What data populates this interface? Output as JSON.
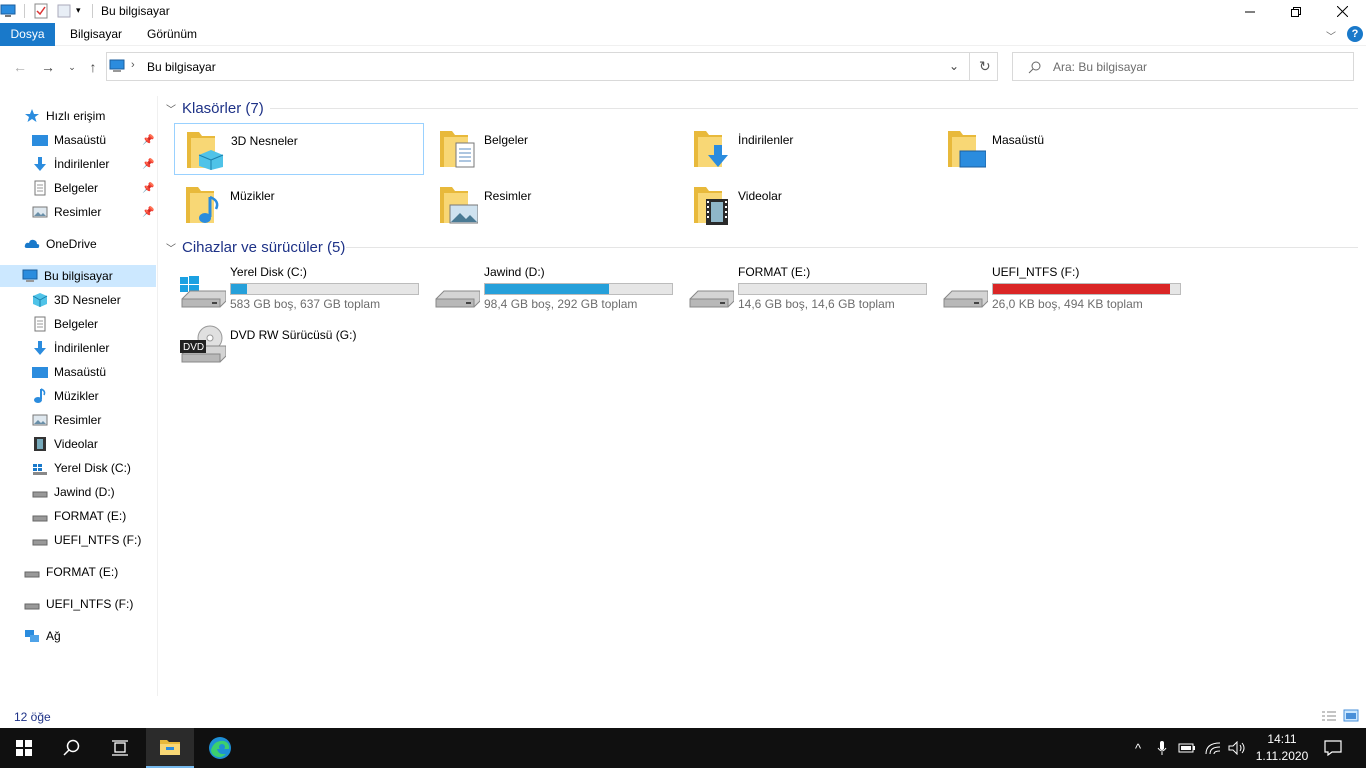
{
  "window": {
    "title": "Bu bilgisayar"
  },
  "ribbon": {
    "tabs": [
      "Dosya",
      "Bilgisayar",
      "Görünüm"
    ]
  },
  "address": {
    "path": "Bu bilgisayar",
    "search_placeholder": "Ara: Bu bilgisayar"
  },
  "sidebar": {
    "quick_access": "Hızlı erişim",
    "quick_items": [
      "Masaüstü",
      "İndirilenler",
      "Belgeler",
      "Resimler"
    ],
    "onedrive": "OneDrive",
    "this_pc": "Bu bilgisayar",
    "pc_items": [
      "3D Nesneler",
      "Belgeler",
      "İndirilenler",
      "Masaüstü",
      "Müzikler",
      "Resimler",
      "Videolar",
      "Yerel Disk (C:)",
      "Jawind (D:)",
      "FORMAT (E:)",
      "UEFI_NTFS (F:)"
    ],
    "extra_drives": [
      "FORMAT (E:)",
      "UEFI_NTFS (F:)"
    ],
    "network": "Ağ"
  },
  "content": {
    "folders_header": "Klasörler (7)",
    "folders": [
      "3D Nesneler",
      "Belgeler",
      "İndirilenler",
      "Masaüstü",
      "Müzikler",
      "Resimler",
      "Videolar"
    ],
    "devices_header": "Cihazlar ve sürücüler (5)",
    "drives": [
      {
        "name": "Yerel Disk (C:)",
        "info": "583 GB boş, 637 GB toplam",
        "used_fraction": 0.085,
        "color": "#26a0da"
      },
      {
        "name": "Jawind (D:)",
        "info": "98,4 GB boş, 292 GB toplam",
        "used_fraction": 0.663,
        "color": "#26a0da"
      },
      {
        "name": "FORMAT (E:)",
        "info": "14,6 GB boş, 14,6 GB toplam",
        "used_fraction": 0.0,
        "color": "#26a0da"
      },
      {
        "name": "UEFI_NTFS (F:)",
        "info": "26,0 KB boş, 494 KB toplam",
        "used_fraction": 0.947,
        "color": "#da2626"
      }
    ],
    "dvd": {
      "name": "DVD RW Sürücüsü (G:)",
      "badge": "DVD"
    }
  },
  "status": {
    "count": "12 öğe"
  },
  "taskbar": {
    "time": "14:11",
    "date": "1.11.2020"
  }
}
